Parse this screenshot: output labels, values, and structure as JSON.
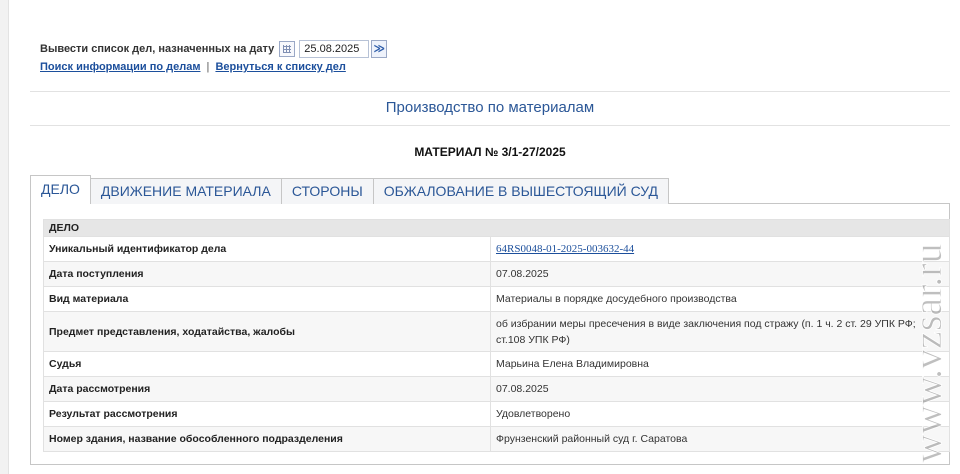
{
  "header": {
    "date_label": "Вывести список дел, назначенных на дату",
    "date_value": "25.08.2025",
    "go_symbol": "≫",
    "link_search": "Поиск информации по делам",
    "link_separator": "|",
    "link_back": "Вернуться к списку дел"
  },
  "section_title": "Производство по материалам",
  "material_title": "МАТЕРИАЛ № 3/1-27/2025",
  "tabs": [
    {
      "label": "ДЕЛО",
      "active": true
    },
    {
      "label": "ДВИЖЕНИЕ МАТЕРИАЛА",
      "active": false
    },
    {
      "label": "СТОРОНЫ",
      "active": false
    },
    {
      "label": "ОБЖАЛОВАНИЕ В ВЫШЕСТОЯЩИЙ СУД",
      "active": false
    }
  ],
  "table": {
    "header": "ДЕЛО",
    "rows": [
      {
        "label": "Уникальный идентификатор дела",
        "value": "64RS0048-01-2025-003632-44"
      },
      {
        "label": "Дата поступления",
        "value": "07.08.2025"
      },
      {
        "label": "Вид материала",
        "value": "Материалы в порядке досудебного производства"
      },
      {
        "label": "Предмет представления, ходатайства, жалобы",
        "value": "об избрании меры пресечения в виде заключения под стражу (п. 1 ч. 2 ст. 29 УПК РФ; ст.108 УПК РФ)"
      },
      {
        "label": "Судья",
        "value": "Марьина Елена Владимировна"
      },
      {
        "label": "Дата рассмотрения",
        "value": "07.08.2025"
      },
      {
        "label": "Результат рассмотрения",
        "value": "Удовлетворено"
      },
      {
        "label": "Номер здания, название обособленного подразделения",
        "value": "Фрунзенский районный суд г. Саратова"
      }
    ]
  },
  "watermark": "www.vzsar.ru",
  "colors": {
    "link": "#1c4f9c",
    "title": "#2b5797"
  }
}
